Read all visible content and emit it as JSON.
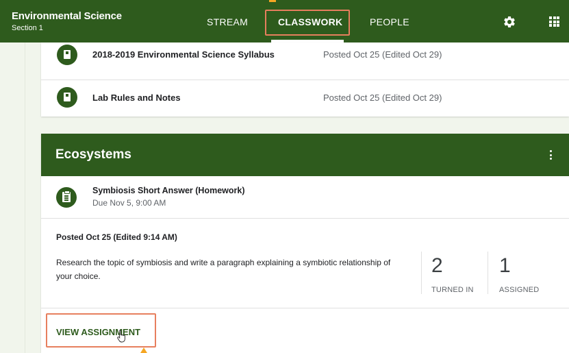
{
  "header": {
    "class_name": "Environmental Science",
    "section": "Section 1",
    "tabs": [
      {
        "label": "STREAM"
      },
      {
        "label": "CLASSWORK",
        "active": true
      },
      {
        "label": "PEOPLE"
      }
    ],
    "icons": [
      "gear-icon",
      "apps-icon"
    ]
  },
  "materials": [
    {
      "title": "2018-2019 Environmental Science Syllabus",
      "posted": "Posted Oct 25 (Edited Oct 29)",
      "icon": "material-icon"
    },
    {
      "title": "Lab Rules and Notes",
      "posted": "Posted Oct 25 (Edited Oct 29)",
      "icon": "material-icon"
    }
  ],
  "topic": {
    "title": "Ecosystems",
    "assignment": {
      "title": "Symbiosis Short Answer (Homework)",
      "due": "Due Nov 5, 9:00 AM",
      "posted": "Posted Oct 25 (Edited 9:14 AM)",
      "description": "Research the topic of symbiosis and write a paragraph explaining a symbiotic relationship of your choice.",
      "stats": [
        {
          "value": "2",
          "label": "TURNED IN"
        },
        {
          "value": "1",
          "label": "ASSIGNED"
        }
      ],
      "view_label": "VIEW ASSIGNMENT"
    }
  },
  "colors": {
    "primary": "#2e5b1d",
    "highlight": "#e77f5e",
    "background": "#f1f5ec"
  }
}
